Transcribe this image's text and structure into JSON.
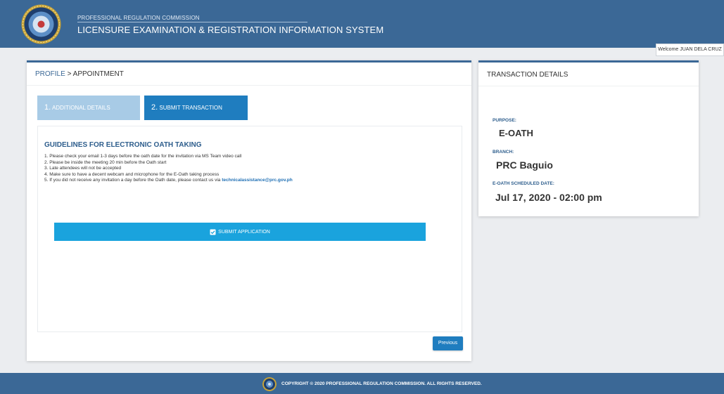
{
  "header": {
    "org": "PROFESSIONAL REGULATION COMMISSION",
    "system": "LICENSURE EXAMINATION & REGISTRATION INFORMATION SYSTEM",
    "logo_icon": "prc-seal-icon"
  },
  "user": {
    "welcome": "Welcome JUAN DELA CRUZ"
  },
  "breadcrumb": {
    "profile": "PROFILE",
    "separator": " > ",
    "current": "APPOINTMENT"
  },
  "steps": [
    {
      "num": "1.",
      "label": "ADDITIONAL DETAILS",
      "state": "completed"
    },
    {
      "num": "2.",
      "label": "SUBMIT TRANSACTION",
      "state": "active"
    }
  ],
  "guidelines": {
    "title": "GUIDELINES FOR ELECTRONIC OATH TAKING",
    "items": [
      "1. Please check your email 1-3 days before the oath date for the invitation via MS Team video call",
      "2. Please be inside the meeting 20 min before the Oath start",
      "3. Late attendees will not be accepted",
      "4. Make sure to have a decent webcam and microphone for the E-Oath taking process"
    ],
    "item5_prefix": "5. If you did not receive any invitation a day before the Oath date, please contact us via ",
    "item5_email": "technicalassistance@prc.gov.ph"
  },
  "buttons": {
    "submit": "SUBMIT APPLICATION",
    "submit_icon": "checkbox-check-icon",
    "previous": "Previous"
  },
  "transaction": {
    "title": "TRANSACTION DETAILS",
    "purpose_label": "PURPOSE:",
    "purpose_value": "E-OATH",
    "branch_label": "BRANCH:",
    "branch_value": "PRC Baguio",
    "date_label": "E-OATH SCHEDULED DATE:",
    "date_value": "Jul 17, 2020 - 02:00 pm"
  },
  "footer": {
    "copyright": "COPYRIGHT © 2020 PROFESSIONAL REGULATION COMMISSION. ALL RIGHTS RESERVED."
  },
  "colors": {
    "brand": "#3b6896",
    "accent": "#1aa3dd",
    "step_active": "#1f7dbf",
    "step_done": "#a8cbe6"
  }
}
